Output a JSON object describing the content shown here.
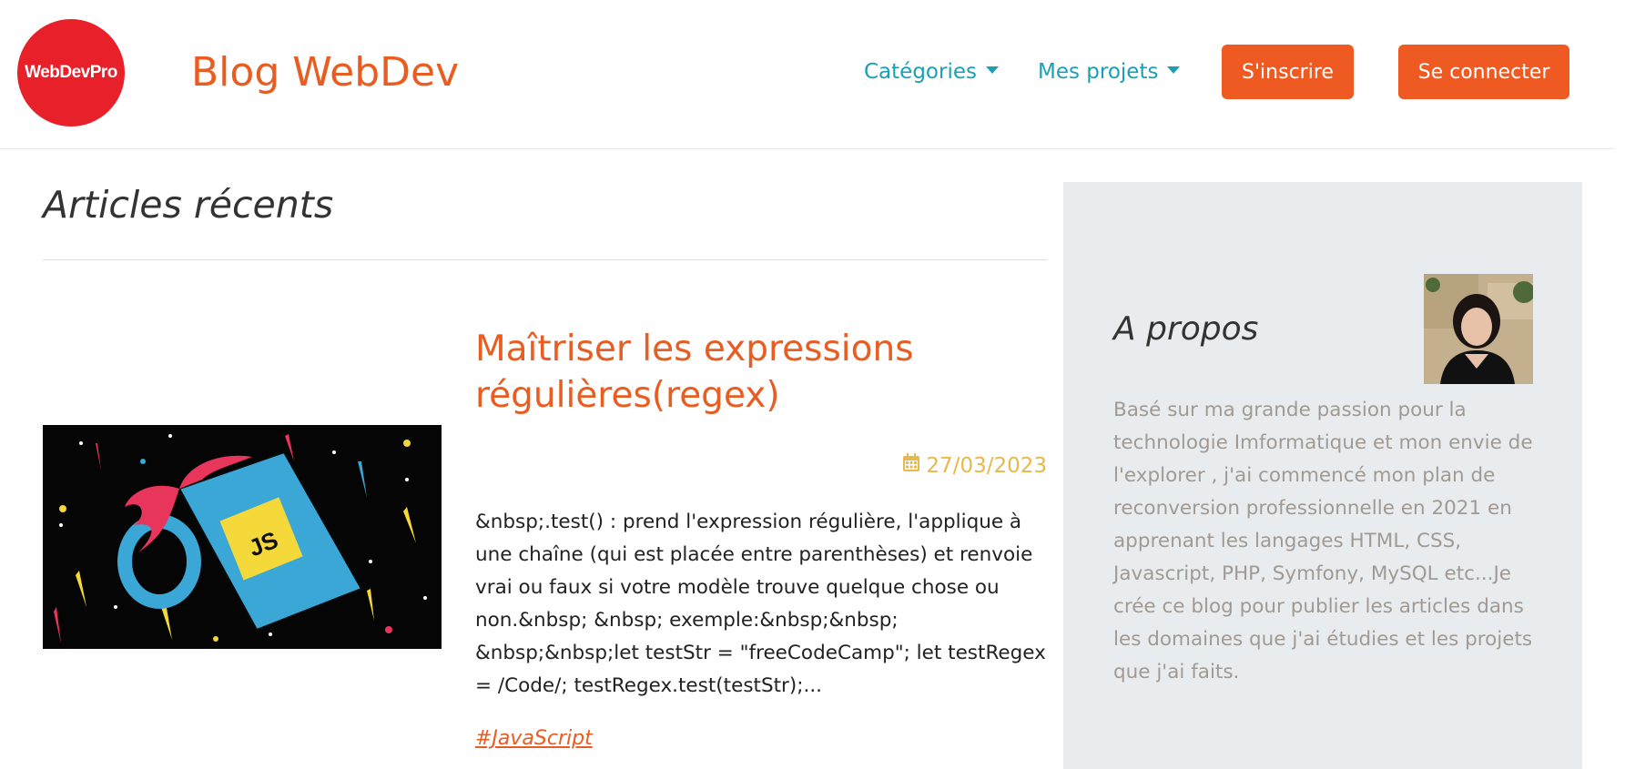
{
  "header": {
    "logo_text": "WebDevPro",
    "site_title": "Blog WebDev",
    "nav": {
      "categories_label": "Catégories",
      "projects_label": "Mes projets"
    },
    "signup_label": "S'inscrire",
    "login_label": "Se connecter"
  },
  "main": {
    "section_title": "Articles récents",
    "article": {
      "title": "Maîtriser les expressions régulières(regex)",
      "date": "27/03/2023",
      "excerpt": "&nbsp;.test() : prend l'expression régulière, l'applique à une chaîne (qui est placée entre parenthèses) et renvoie vrai ou faux si votre modèle trouve quelque chose ou non.&nbsp; &nbsp; exemple:&nbsp;&nbsp; &nbsp;&nbsp;let testStr = \"freeCodeCamp\"; let testRegex = /Code/; testRegex.test(testStr);...",
      "tag": "#JavaScript",
      "image_badge": "JS"
    }
  },
  "sidebar": {
    "about_title": "A propos",
    "about_text": "Basé sur ma grande passion pour la technologie Imformatique et mon envie de l'explorer , j'ai commencé mon plan de reconversion professionnelle en 2021 en apprenant les langages HTML, CSS, Javascript, PHP, Symfony, MySQL etc...Je crée ce blog pour publier les articles dans les domaines que j'ai étudies et les projets que j'ai faits."
  },
  "colors": {
    "brand_orange": "#ee5a22",
    "nav_teal": "#1a9fb5",
    "date_gold": "#e8b84a",
    "logo_red": "#e8202a",
    "sidebar_bg": "#e9ecef"
  },
  "icons": {
    "date": "calendar-icon",
    "dropdown": "caret-down-icon"
  }
}
